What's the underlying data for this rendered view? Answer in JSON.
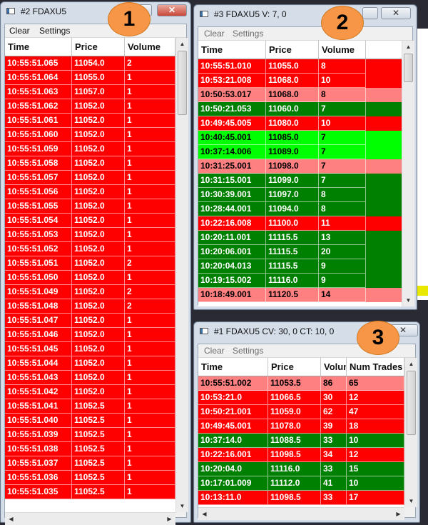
{
  "colors": {
    "red": "#ff0000",
    "pink": "#ff8080",
    "green": "#008000",
    "lime": "#00ff00"
  },
  "windows": [
    {
      "title": "#2 FDAXU5",
      "menu": [
        "Clear",
        "Settings"
      ],
      "columns": [
        "Time",
        "Price",
        "Volume"
      ],
      "rows": [
        [
          "10:55:51.065",
          "11054.0",
          "2",
          "red"
        ],
        [
          "10:55:51.064",
          "11055.0",
          "1",
          "red"
        ],
        [
          "10:55:51.063",
          "11057.0",
          "1",
          "red"
        ],
        [
          "10:55:51.062",
          "11052.0",
          "1",
          "red"
        ],
        [
          "10:55:51.061",
          "11052.0",
          "1",
          "red"
        ],
        [
          "10:55:51.060",
          "11052.0",
          "1",
          "red"
        ],
        [
          "10:55:51.059",
          "11052.0",
          "1",
          "red"
        ],
        [
          "10:55:51.058",
          "11052.0",
          "1",
          "red"
        ],
        [
          "10:55:51.057",
          "11052.0",
          "1",
          "red"
        ],
        [
          "10:55:51.056",
          "11052.0",
          "1",
          "red"
        ],
        [
          "10:55:51.055",
          "11052.0",
          "1",
          "red"
        ],
        [
          "10:55:51.054",
          "11052.0",
          "1",
          "red"
        ],
        [
          "10:55:51.053",
          "11052.0",
          "1",
          "red"
        ],
        [
          "10:55:51.052",
          "11052.0",
          "1",
          "red"
        ],
        [
          "10:55:51.051",
          "11052.0",
          "2",
          "red"
        ],
        [
          "10:55:51.050",
          "11052.0",
          "1",
          "red"
        ],
        [
          "10:55:51.049",
          "11052.0",
          "2",
          "red"
        ],
        [
          "10:55:51.048",
          "11052.0",
          "2",
          "red"
        ],
        [
          "10:55:51.047",
          "11052.0",
          "1",
          "red"
        ],
        [
          "10:55:51.046",
          "11052.0",
          "1",
          "red"
        ],
        [
          "10:55:51.045",
          "11052.0",
          "1",
          "red"
        ],
        [
          "10:55:51.044",
          "11052.0",
          "1",
          "red"
        ],
        [
          "10:55:51.043",
          "11052.0",
          "1",
          "red"
        ],
        [
          "10:55:51.042",
          "11052.0",
          "1",
          "red"
        ],
        [
          "10:55:51.041",
          "11052.5",
          "1",
          "red"
        ],
        [
          "10:55:51.040",
          "11052.5",
          "1",
          "red"
        ],
        [
          "10:55:51.039",
          "11052.5",
          "1",
          "red"
        ],
        [
          "10:55:51.038",
          "11052.5",
          "1",
          "red"
        ],
        [
          "10:55:51.037",
          "11052.5",
          "1",
          "red"
        ],
        [
          "10:55:51.036",
          "11052.5",
          "1",
          "red"
        ],
        [
          "10:55:51.035",
          "11052.5",
          "1",
          "red"
        ]
      ],
      "badge": "1"
    },
    {
      "title": "#3 FDAXU5  V: 7, 0",
      "menu": [
        "Clear",
        "Settings"
      ],
      "columns": [
        "Time",
        "Price",
        "Volume"
      ],
      "rows": [
        [
          "10:55:51.010",
          "11055.0",
          "8",
          "red"
        ],
        [
          "10:53:21.008",
          "11068.0",
          "10",
          "red"
        ],
        [
          "10:50:53.017",
          "11068.0",
          "8",
          "pink"
        ],
        [
          "10:50:21.053",
          "11060.0",
          "7",
          "green"
        ],
        [
          "10:49:45.005",
          "11080.0",
          "10",
          "red"
        ],
        [
          "10:40:45.001",
          "11085.0",
          "7",
          "lime"
        ],
        [
          "10:37:14.006",
          "11089.0",
          "7",
          "lime"
        ],
        [
          "10:31:25.001",
          "11098.0",
          "7",
          "pink"
        ],
        [
          "10:31:15.001",
          "11099.0",
          "7",
          "green"
        ],
        [
          "10:30:39.001",
          "11097.0",
          "8",
          "green"
        ],
        [
          "10:28:44.001",
          "11094.0",
          "8",
          "green"
        ],
        [
          "10:22:16.008",
          "11100.0",
          "11",
          "red"
        ],
        [
          "10:20:11.001",
          "11115.5",
          "13",
          "green"
        ],
        [
          "10:20:06.001",
          "11115.5",
          "20",
          "green"
        ],
        [
          "10:20:04.013",
          "11115.5",
          "9",
          "green"
        ],
        [
          "10:19:15.002",
          "11116.0",
          "9",
          "green"
        ],
        [
          "10:18:49.001",
          "11120.5",
          "14",
          "pink"
        ]
      ],
      "badge": "2"
    },
    {
      "title": "#1 FDAXU5  CV: 30, 0  CT: 10, 0",
      "menu": [
        "Clear",
        "Settings"
      ],
      "columns": [
        "Time",
        "Price",
        "Volume",
        "Num Trades"
      ],
      "rows": [
        [
          "10:55:51.002",
          "11053.5",
          "86",
          "65",
          "pink"
        ],
        [
          "10:53:21.0",
          "11066.5",
          "30",
          "12",
          "red"
        ],
        [
          "10:50:21.001",
          "11059.0",
          "62",
          "47",
          "red"
        ],
        [
          "10:49:45.001",
          "11078.0",
          "39",
          "18",
          "red"
        ],
        [
          "10:37:14.0",
          "11088.5",
          "33",
          "10",
          "green"
        ],
        [
          "10:22:16.001",
          "11098.5",
          "34",
          "12",
          "red"
        ],
        [
          "10:20:04.0",
          "11116.0",
          "33",
          "15",
          "green"
        ],
        [
          "10:17:01.009",
          "11112.0",
          "41",
          "10",
          "green"
        ],
        [
          "10:13:11.0",
          "11098.5",
          "33",
          "17",
          "red"
        ]
      ],
      "badge": "3"
    }
  ],
  "icons": {
    "close": "close-icon",
    "minimize": "minimize-icon",
    "maximize": "maximize-icon",
    "scroll_up": "arrow-up-icon",
    "scroll_down": "arrow-down-icon",
    "scroll_left": "arrow-left-icon",
    "scroll_right": "arrow-right-icon"
  },
  "glyphs": {
    "close": "✕",
    "up": "▲",
    "down": "▼",
    "left": "◀",
    "right": "▶"
  }
}
